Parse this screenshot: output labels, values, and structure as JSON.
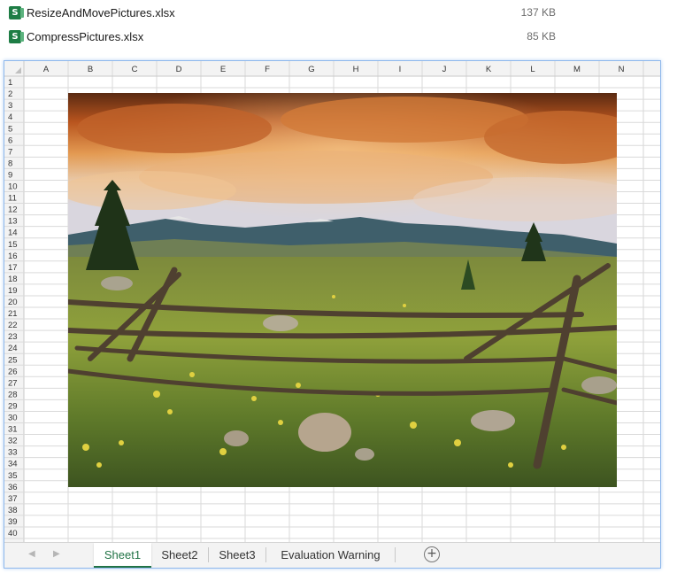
{
  "files": [
    {
      "name": "ResizeAndMovePictures.xlsx",
      "size": "137 KB",
      "icon": "excel-file-icon"
    },
    {
      "name": "CompressPictures.xlsx",
      "size": "85 KB",
      "icon": "excel-file-icon"
    }
  ],
  "spreadsheet": {
    "columns": [
      "A",
      "B",
      "C",
      "D",
      "E",
      "F",
      "G",
      "H",
      "I",
      "J",
      "K",
      "L",
      "M",
      "N"
    ],
    "row_count": 40,
    "picture": "landscape-photo-fence-meadow-mountains",
    "tabs": [
      {
        "label": "Sheet1",
        "active": true
      },
      {
        "label": "Sheet2",
        "active": false
      },
      {
        "label": "Sheet3",
        "active": false
      },
      {
        "label": "Evaluation Warning",
        "active": false
      }
    ],
    "nav": {
      "prev": "◀",
      "next": "▶"
    },
    "add_sheet_symbol": "+",
    "accent_color": "#217346",
    "window_border_color": "#8fb8ec"
  }
}
